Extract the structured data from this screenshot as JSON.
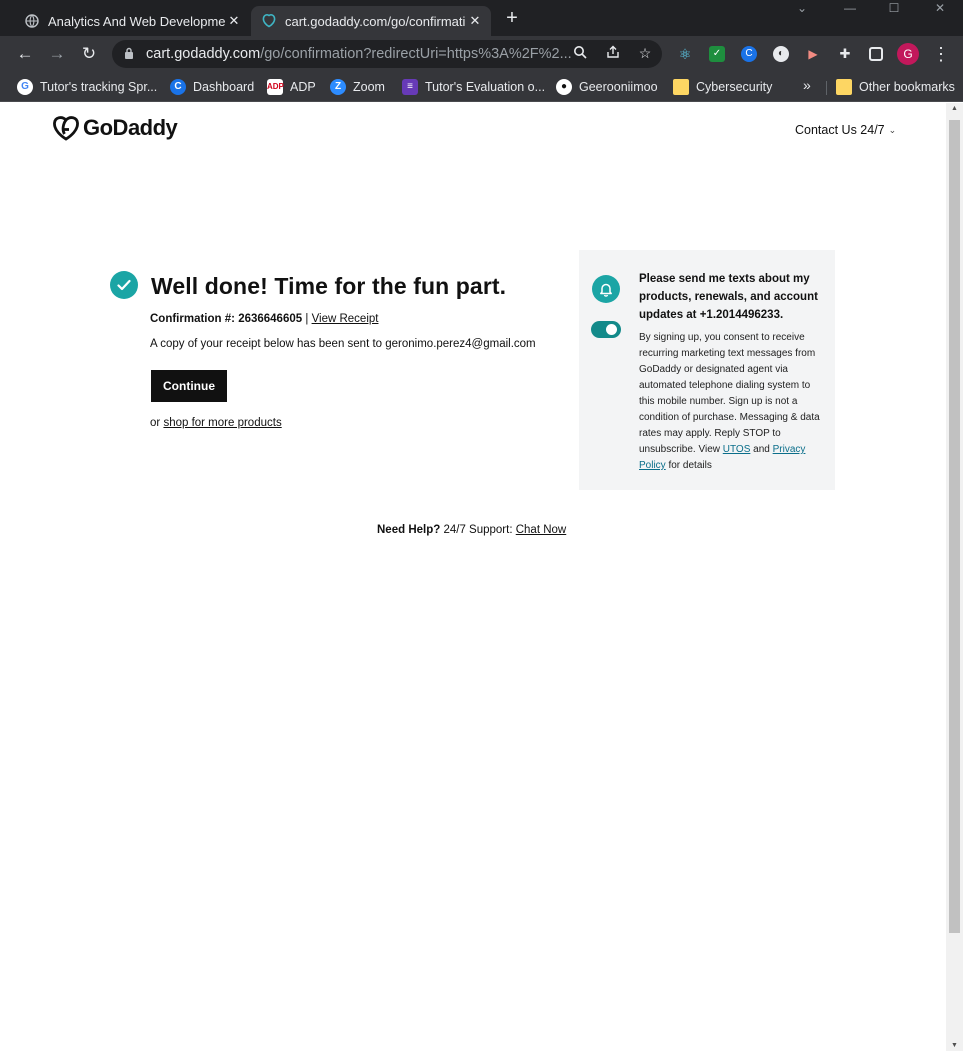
{
  "browser": {
    "tabs": [
      {
        "title": "Analytics And Web Development",
        "close": "✕",
        "active": false
      },
      {
        "title": "cart.godaddy.com/go/confirmati",
        "close": "✕",
        "active": true
      }
    ],
    "new_tab": "+",
    "address": {
      "host": "cart.godaddy.com",
      "path": "/go/confirmation?redirectUri=https%3A%2F%2..."
    },
    "profile_initial": "G",
    "bookmarks": [
      {
        "label": "Tutor's tracking Spr...",
        "icon": "google-icon"
      },
      {
        "label": "Dashboard",
        "icon": "dashboard-icon"
      },
      {
        "label": "ADP",
        "icon": "adp-icon"
      },
      {
        "label": "Zoom",
        "icon": "zoom-icon"
      },
      {
        "label": "Tutor's Evaluation o...",
        "icon": "forms-icon"
      },
      {
        "label": "Geerooniimoo",
        "icon": "github-icon"
      },
      {
        "label": "Cybersecurity",
        "icon": "folder-icon"
      }
    ],
    "bookmarks_overflow": "»",
    "other_bookmarks": "Other bookmarks"
  },
  "header": {
    "logo_text": "GoDaddy",
    "contact_label": "Contact Us 24/7"
  },
  "confirmation": {
    "headline": "Well done! Time for the fun part.",
    "number_label": "Confirmation #:",
    "number": "2636646605",
    "separator": "|",
    "view_receipt": "View Receipt",
    "receipt_note": "A copy of your receipt below has been sent to geronimo.perez4@gmail.com",
    "continue_label": "Continue",
    "shop_prefix": "or",
    "shop_link": "shop for more products"
  },
  "sms": {
    "title": "Please send me texts about my products, renewals, and account updates at +1.2014496233.",
    "legal_text": "By signing up, you consent to receive recurring marketing text messages from GoDaddy or designated agent via automated telephone dialing system to this mobile number. Sign up is not a condition of purchase. Messaging & data rates may apply. Reply STOP to unsubscribe. View",
    "utos_link": "UTOS",
    "and_text": "and",
    "privacy_link": "Privacy Policy",
    "tail_text": "for details",
    "toggle_on": true
  },
  "help": {
    "label": "Need Help?",
    "support": "24/7 Support:",
    "chat_link": "Chat Now"
  },
  "colors": {
    "teal": "#1ba5a5",
    "toggle": "#138a8a",
    "panel_bg": "#f3f4f5"
  }
}
